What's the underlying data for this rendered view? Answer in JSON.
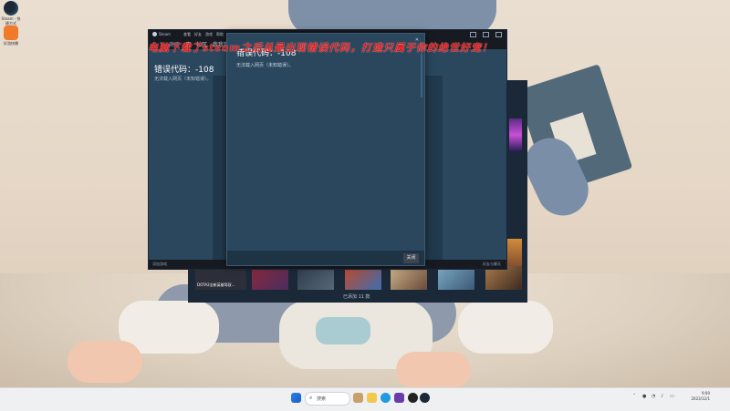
{
  "desktop": {
    "icons": [
      {
        "name": "steam-shortcut",
        "label": "Steam - 快捷方式"
      },
      {
        "name": "app-shortcut",
        "label": "好游快爆"
      }
    ]
  },
  "overlay_banner": {
    "text": "电脑下载了steam之后总是出现错误代码，打造只属于你的绝世好宠！"
  },
  "steam_window": {
    "title": "Steam",
    "menu": [
      "查看",
      "好友",
      "游戏",
      "帮助"
    ],
    "nav": [
      "商店",
      "库",
      "社区",
      "我我我"
    ],
    "error_code": "错误代码：-108",
    "error_message": "无法载入网页（未知错误）。",
    "footer_left": "添加游戏",
    "footer_right": "好友与聊天"
  },
  "dialog": {
    "title": "错误代码：-108",
    "message": "无法载入网页（未知错误）。",
    "close_label": "关闭"
  },
  "store_window": {
    "tile_caption": "DOTA2全新英雄驾驭...",
    "footer_text": "已添加 11 款"
  },
  "taskbar": {
    "search_label": "搜索",
    "clock_time": "9:00",
    "clock_date": "2023/12/1"
  }
}
